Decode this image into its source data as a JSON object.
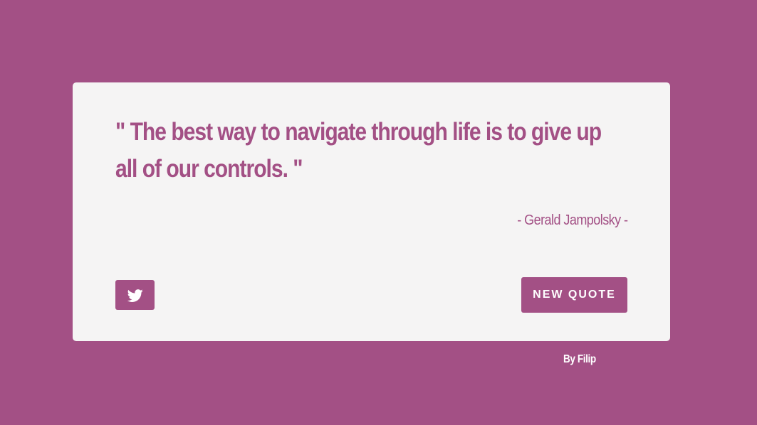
{
  "colors": {
    "background": "#a35085",
    "card": "#f5f4f4",
    "accent": "#a35085",
    "button_text": "#ffffff"
  },
  "quote": {
    "text": "\" The best way to navigate through life is to give up all of our controls. \"",
    "author": "- Gerald Jampolsky -"
  },
  "actions": {
    "tweet_icon": "twitter-icon",
    "new_quote_label": "NEW QUOTE"
  },
  "footer": {
    "credit": "By Filip"
  }
}
